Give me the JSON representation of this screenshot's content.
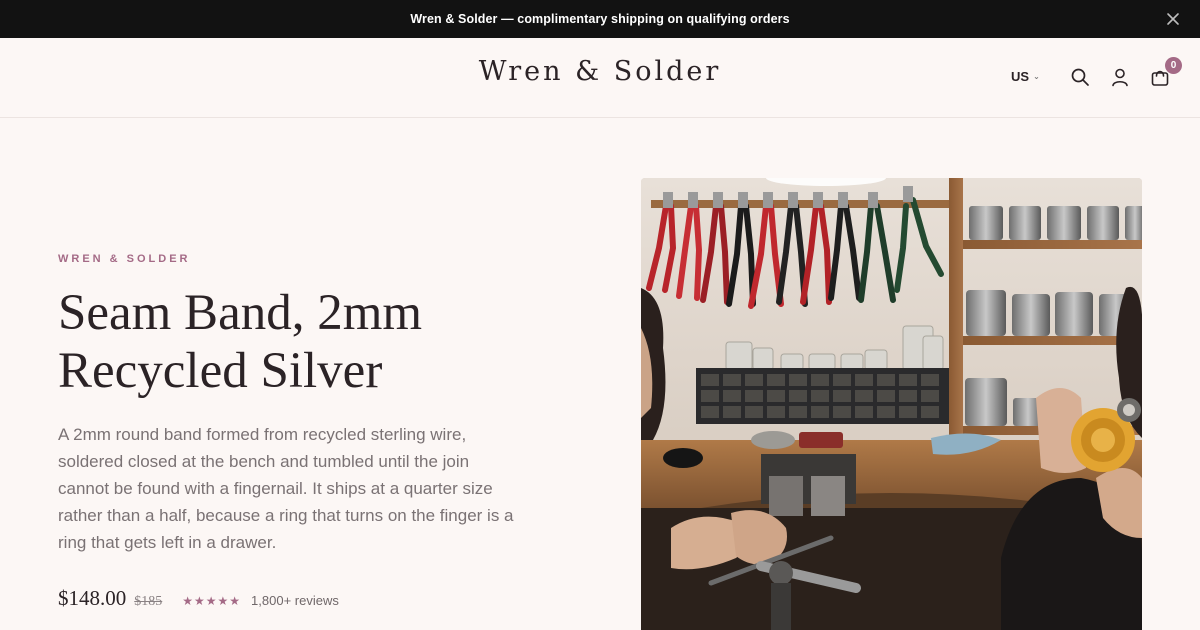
{
  "announcement": {
    "text": "Wren & Solder — complimentary shipping on qualifying orders",
    "close_icon": "close-icon"
  },
  "header": {
    "logo": "Wren & Solder",
    "locale": "US",
    "icons": [
      "search-icon",
      "account-icon",
      "cart-icon"
    ],
    "cart_count": "0"
  },
  "hero": {
    "eyebrow": "WREN & SOLDER",
    "title_line1": "Seam Band, 2mm",
    "title_line2": "Recycled Silver",
    "description": "A 2mm round band formed from recycled sterling wire, soldered closed at the bench and tumbled until the join cannot be found with a fingernail. It ships at a quarter size rather than a half, because a ring that turns on the finger is a ring that gets left in a drawer.",
    "price": "$148.00",
    "compare_price": "$185",
    "stars": "★★★★★",
    "rating": 5,
    "reviews": "1,800+ reviews"
  },
  "colors": {
    "announcement_bg": "#121212",
    "page_bg": "#fcf7f5",
    "accent": "#a46a86",
    "text": "#2b2326",
    "muted_text": "#7a7274"
  }
}
